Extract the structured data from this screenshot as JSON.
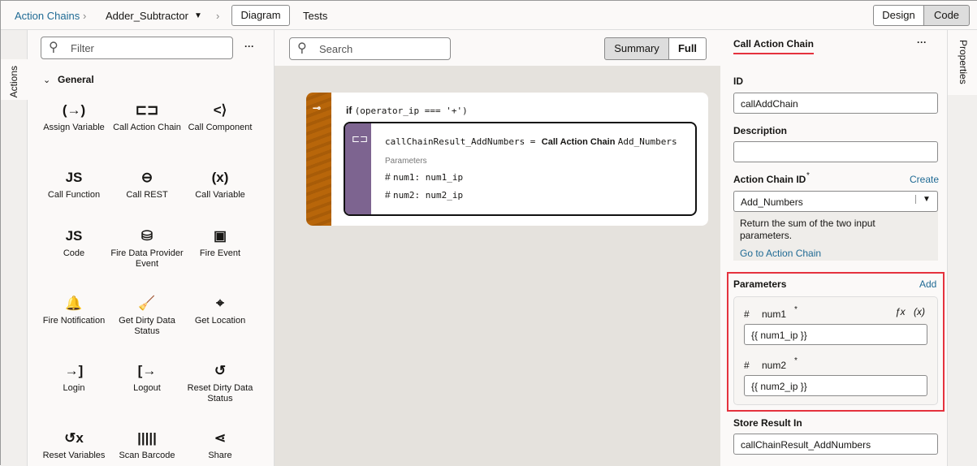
{
  "topbar": {
    "crumb1": "Action Chains",
    "crumb2": "Adder_Subtractor",
    "tab_diagram": "Diagram",
    "tab_tests": "Tests",
    "design": "Design",
    "code": "Code"
  },
  "left_tab": "Actions",
  "actions_panel": {
    "filter_placeholder": "Filter",
    "more": "···",
    "group": "General",
    "items": [
      {
        "icon": "(→)",
        "label": "Assign Variable"
      },
      {
        "icon": "⊏⊐",
        "label": "Call Action Chain"
      },
      {
        "icon": "<⟩",
        "label": "Call Component"
      },
      {
        "icon": "JS",
        "label": "Call Function"
      },
      {
        "icon": "⊖",
        "label": "Call REST"
      },
      {
        "icon": "(x)",
        "label": "Call Variable"
      },
      {
        "icon": "JS",
        "label": "Code"
      },
      {
        "icon": "⛁",
        "label": "Fire Data Provider Event"
      },
      {
        "icon": "▣",
        "label": "Fire Event"
      },
      {
        "icon": "🔔",
        "label": "Fire Notification"
      },
      {
        "icon": "🧹",
        "label": "Get Dirty Data Status"
      },
      {
        "icon": "⌖",
        "label": "Get Location"
      },
      {
        "icon": "→]",
        "label": "Login"
      },
      {
        "icon": "[→",
        "label": "Logout"
      },
      {
        "icon": "↺",
        "label": "Reset Dirty Data Status"
      },
      {
        "icon": "↺x",
        "label": "Reset Variables"
      },
      {
        "icon": "|||||",
        "label": "Scan Barcode"
      },
      {
        "icon": "⋖",
        "label": "Share"
      }
    ]
  },
  "canvas": {
    "search_placeholder": "Search",
    "summary": "Summary",
    "full": "Full",
    "if_kw": "if",
    "condition": "(operator_ip === '+')",
    "assign_lhs": "callChainResult_AddNumbers =",
    "action_name": "Call Action Chain",
    "chain": "Add_Numbers",
    "params_label": "Parameters",
    "params": [
      "num1: num1_ip",
      "num2: num2_ip"
    ]
  },
  "properties": {
    "title": "Call Action Chain",
    "more": "···",
    "id_label": "ID",
    "id_value": "callAddChain",
    "desc_label": "Description",
    "desc_value": "",
    "chain_id_label": "Action Chain ID",
    "required": "*",
    "create": "Create",
    "chain_id_value": "Add_Numbers",
    "chain_desc": "Return the sum of the two input parameters.",
    "goto": "Go to Action Chain",
    "params_label": "Parameters",
    "add": "Add",
    "params": [
      {
        "name": "num1",
        "value": "{{ num1_ip }}"
      },
      {
        "name": "num2",
        "value": "{{ num2_ip }}"
      }
    ],
    "fx": "ƒx",
    "var": "(x)",
    "store_label": "Store Result In",
    "store_value": "callChainResult_AddNumbers"
  },
  "right_tab": "Properties",
  "colors": {
    "accent_red": "#e5323e",
    "link": "#1f6a94",
    "action_strip": "#7d6490",
    "if_strip": "#b8660a"
  }
}
